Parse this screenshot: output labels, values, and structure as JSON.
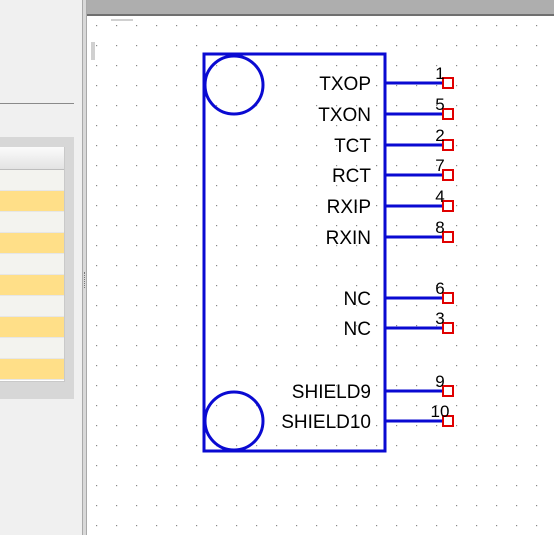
{
  "component": {
    "pins": [
      {
        "number": "1",
        "name": "TXOP"
      },
      {
        "number": "5",
        "name": "TXON"
      },
      {
        "number": "2",
        "name": "TCT"
      },
      {
        "number": "7",
        "name": "RCT"
      },
      {
        "number": "4",
        "name": "RXIP"
      },
      {
        "number": "8",
        "name": "RXIN"
      },
      {
        "number": "6",
        "name": "NC"
      },
      {
        "number": "3",
        "name": "NC"
      },
      {
        "number": "9",
        "name": "SHIELD9"
      },
      {
        "number": "10",
        "name": "SHIELD10"
      }
    ]
  },
  "colors": {
    "body": "#0a0ad2",
    "pin_end": "#e00000",
    "canvas_dot": "#888888",
    "row_highlight": "#ffdf88"
  }
}
